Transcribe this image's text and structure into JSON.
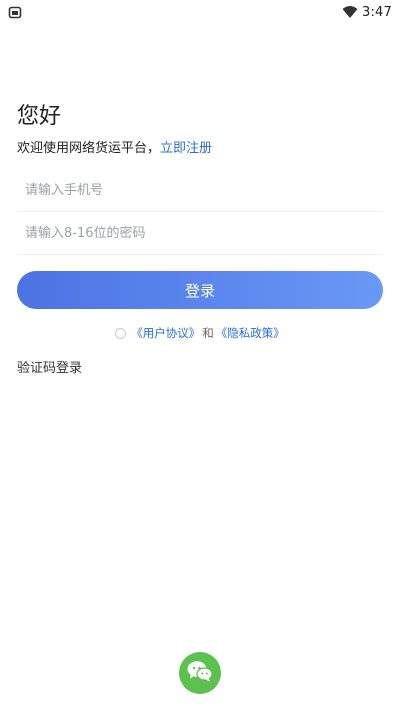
{
  "status_bar": {
    "time": "3:47"
  },
  "login": {
    "greeting": "您好",
    "subtitle_prefix": "欢迎使用网络货运平台，",
    "register_link": "立即注册",
    "phone_placeholder": "请输入手机号",
    "password_placeholder": "请输入8-16位的密码",
    "login_button": "登录",
    "agreement_user": "《用户协议》",
    "agreement_and": "和",
    "agreement_privacy": "《隐私政策》",
    "sms_login": "验证码登录"
  },
  "colors": {
    "accent": "#2a6fd1",
    "button_gradient_start": "#4b73e3",
    "button_gradient_end": "#6a98f6",
    "wechat": "#5cc14f"
  }
}
